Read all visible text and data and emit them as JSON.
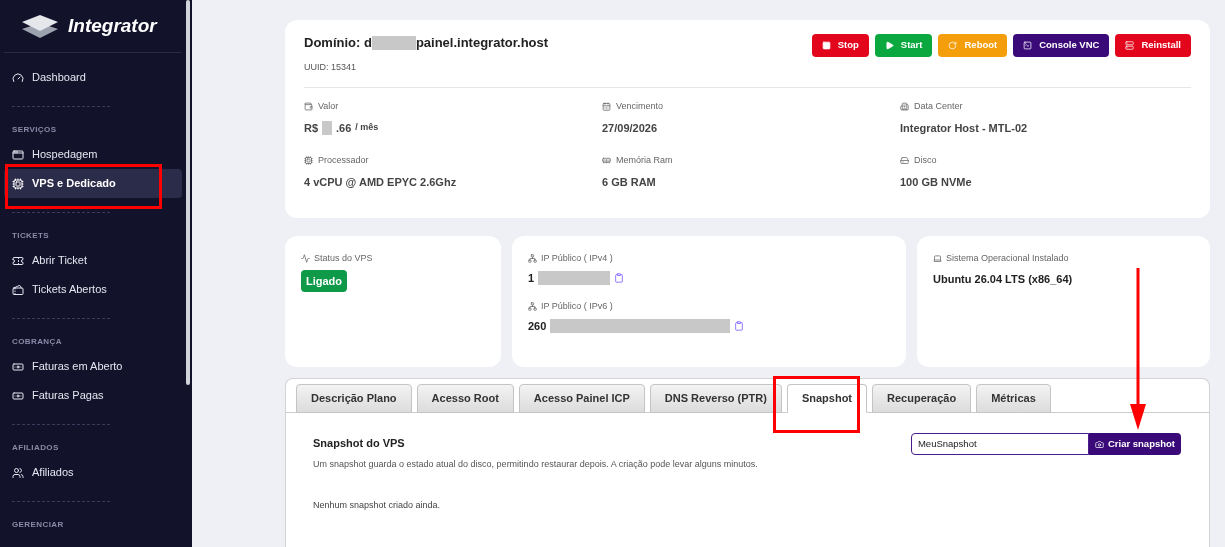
{
  "sidebar": {
    "brand": "Integrator",
    "sections": [
      {
        "items": [
          {
            "label": "Dashboard",
            "kind": "gauge",
            "selected": false
          }
        ]
      },
      {
        "heading": "SERVIÇOS",
        "items": [
          {
            "label": "Hospedagem",
            "kind": "window",
            "selected": false
          },
          {
            "label": "VPS e Dedicado",
            "kind": "cpu",
            "selected": true
          }
        ]
      },
      {
        "heading": "TICKETS",
        "items": [
          {
            "label": "Abrir Ticket",
            "kind": "ticket",
            "selected": false
          },
          {
            "label": "Tickets Abertos",
            "kind": "tickets",
            "selected": false
          }
        ]
      },
      {
        "heading": "COBRANÇA",
        "items": [
          {
            "label": "Faturas em Aberto",
            "kind": "bill",
            "selected": false
          },
          {
            "label": "Faturas Pagas",
            "kind": "bill",
            "selected": false
          }
        ]
      },
      {
        "heading": "AFILIADOS",
        "items": [
          {
            "label": "Afiliados",
            "kind": "users",
            "selected": false
          }
        ]
      },
      {
        "heading": "GERENCIAR"
      }
    ]
  },
  "server": {
    "domain_prefix": "Domínio: d",
    "domain_suffix": "painel.integrator.host",
    "uuid": "UUID: 15341",
    "actions": [
      {
        "label": "Stop",
        "kind": "stop"
      },
      {
        "label": "Start",
        "kind": "start"
      },
      {
        "label": "Reboot",
        "kind": "reboot"
      },
      {
        "label": "Console VNC",
        "kind": "console"
      },
      {
        "label": "Reinstall",
        "kind": "reinstall"
      }
    ],
    "specs": [
      {
        "label": "Valor",
        "kind": "money",
        "value_prefix": "R$",
        "value": ".66",
        "unit": "/ mês"
      },
      {
        "label": "Vencimento",
        "kind": "calendar",
        "value": "27/09/2026"
      },
      {
        "label": "Data Center",
        "kind": "building",
        "value": "Integrator Host - MTL-02"
      },
      {
        "label": "Processador",
        "kind": "cpu",
        "value": "4 vCPU @ AMD EPYC 2.6Ghz"
      },
      {
        "label": "Memória Ram",
        "kind": "memory",
        "value": "6 GB RAM"
      },
      {
        "label": "Disco",
        "kind": "disk",
        "value": "100 GB NVMe"
      }
    ]
  },
  "status": {
    "label": "Status do VPS",
    "badge": "Ligado",
    "on": true
  },
  "ips": [
    {
      "label": "IP Público ( IPv4 )",
      "value": "1"
    },
    {
      "label": "IP Público ( IPv6 )",
      "value": "260"
    }
  ],
  "os": {
    "label": "Sistema Operacional Instalado",
    "value": "Ubuntu 26.04 LTS (x86_64)"
  },
  "tabs": [
    {
      "label": "Descrição Plano",
      "selected": false
    },
    {
      "label": "Acesso Root",
      "selected": false
    },
    {
      "label": "Acesso Painel ICP",
      "selected": false
    },
    {
      "label": "DNS Reverso (PTR)",
      "selected": false
    },
    {
      "label": "Snapshot",
      "selected": true
    },
    {
      "label": "Recuperação",
      "selected": false
    },
    {
      "label": "Métricas",
      "selected": false
    }
  ],
  "snapshot": {
    "title": "Snapshot do VPS",
    "description": "Um snapshot guarda o estado atual do disco, permitindo restaurar depois. A criação pode levar alguns minutos.",
    "name_value": "MeuSnapshot",
    "button": "Criar snapshot",
    "empty": "Nenhum snapshot criado ainda."
  }
}
